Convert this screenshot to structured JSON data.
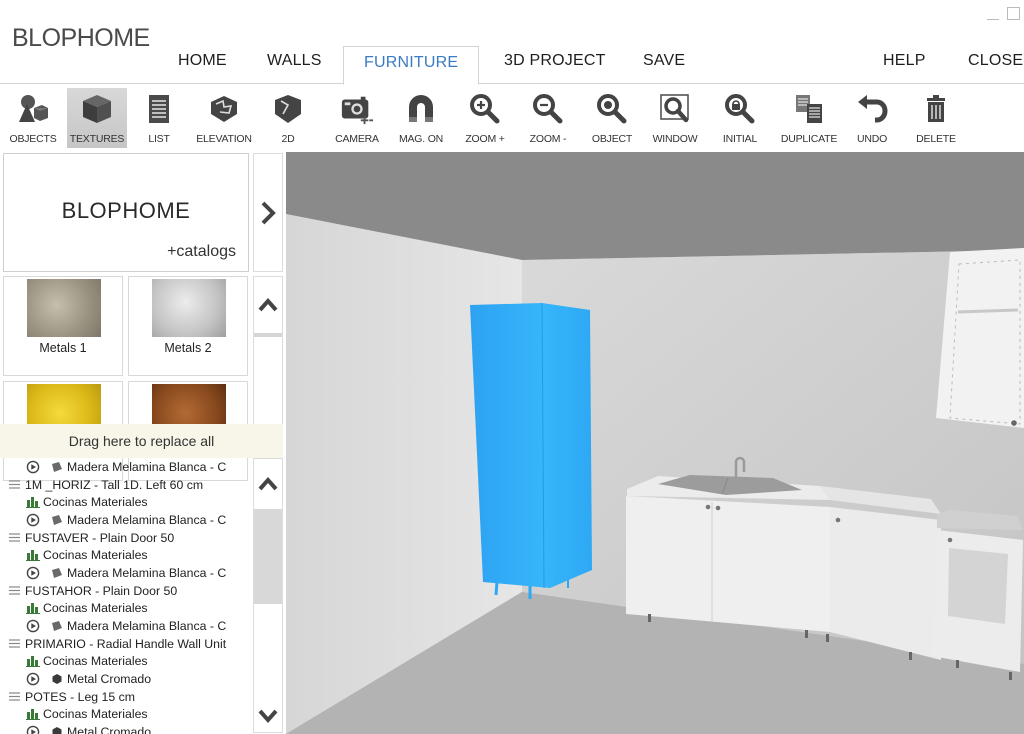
{
  "app": {
    "title": "BLOPHOME",
    "window_controls": {
      "minimize": "minimize",
      "maximize": "maximize"
    }
  },
  "menu": {
    "items": [
      {
        "label": "HOME",
        "active": false
      },
      {
        "label": "WALLS",
        "active": false
      },
      {
        "label": "FURNITURE",
        "active": true
      },
      {
        "label": "3D PROJECT",
        "active": false
      },
      {
        "label": "SAVE",
        "active": false
      },
      {
        "label": "HELP",
        "active": false
      },
      {
        "label": "CLOSE",
        "active": false
      }
    ]
  },
  "toolbar": {
    "tools": [
      {
        "label": "OBJECTS",
        "icon": "objects-icon",
        "active": false
      },
      {
        "label": "TEXTURES",
        "icon": "cube-icon",
        "active": true
      },
      {
        "label": "LIST",
        "icon": "list-icon",
        "active": false
      },
      {
        "label": "ELEVATION",
        "icon": "elevation-icon",
        "active": false
      },
      {
        "label": "2D",
        "icon": "plan-2d-icon",
        "active": false
      },
      {
        "label": "CAMERA",
        "icon": "camera-icon",
        "active": false
      },
      {
        "label": "MAG. ON",
        "icon": "magnet-icon",
        "active": false
      },
      {
        "label": "ZOOM +",
        "icon": "zoom-in-icon",
        "active": false
      },
      {
        "label": "ZOOM -",
        "icon": "zoom-out-icon",
        "active": false
      },
      {
        "label": "OBJECT",
        "icon": "zoom-object-icon",
        "active": false
      },
      {
        "label": "WINDOW",
        "icon": "zoom-window-icon",
        "active": false
      },
      {
        "label": "INITIAL",
        "icon": "zoom-initial-icon",
        "active": false
      },
      {
        "label": "DUPLICATE",
        "icon": "duplicate-icon",
        "active": false
      },
      {
        "label": "UNDO",
        "icon": "undo-icon",
        "active": false
      },
      {
        "label": "DELETE",
        "icon": "trash-icon",
        "active": false
      }
    ]
  },
  "catalog": {
    "brand": "BLOPHOME",
    "subtitle": "+catalogs"
  },
  "textures": {
    "items": [
      {
        "label": "Metals 1",
        "color": "#a39a88"
      },
      {
        "label": "Metals 2",
        "color": "#c9c9c9"
      },
      {
        "label": "",
        "color": "#e3c21c"
      },
      {
        "label": "",
        "color": "#8a4a1e"
      }
    ]
  },
  "drop_zone": {
    "label": "Drag here to replace all"
  },
  "material_tree": {
    "rows": [
      {
        "level": 2,
        "icon": "play-icon",
        "sub_icon": "material-swatch-icon",
        "text": "Madera Melamina Blanca - C"
      },
      {
        "level": 0,
        "icon": "list-lines-icon",
        "text": "1M _HORIZ - Tall 1D. Left 60 cm"
      },
      {
        "level": 1,
        "icon": "catalog-icon",
        "text": "Cocinas Materiales"
      },
      {
        "level": 2,
        "icon": "play-icon",
        "sub_icon": "material-swatch-icon",
        "text": "Madera Melamina Blanca - C"
      },
      {
        "level": 0,
        "icon": "list-lines-icon",
        "text": "FUSTAVER - Plain Door 50"
      },
      {
        "level": 1,
        "icon": "catalog-icon",
        "text": "Cocinas Materiales"
      },
      {
        "level": 2,
        "icon": "play-icon",
        "sub_icon": "material-swatch-icon",
        "text": "Madera Melamina Blanca - C"
      },
      {
        "level": 0,
        "icon": "list-lines-icon",
        "text": "FUSTAHOR - Plain Door 50"
      },
      {
        "level": 1,
        "icon": "catalog-icon",
        "text": "Cocinas Materiales"
      },
      {
        "level": 2,
        "icon": "play-icon",
        "sub_icon": "material-swatch-icon",
        "text": "Madera Melamina Blanca - C"
      },
      {
        "level": 0,
        "icon": "list-lines-icon",
        "text": "PRIMARIO - Radial Handle Wall Unit"
      },
      {
        "level": 1,
        "icon": "catalog-icon",
        "text": "Cocinas Materiales"
      },
      {
        "level": 2,
        "icon": "play-icon",
        "sub_icon": "metal-swatch-icon",
        "text": "Metal Cromado"
      },
      {
        "level": 0,
        "icon": "list-lines-icon",
        "text": "POTES - Leg 15 cm"
      },
      {
        "level": 1,
        "icon": "catalog-icon",
        "text": "Cocinas Materiales"
      },
      {
        "level": 2,
        "icon": "play-icon",
        "sub_icon": "metal-swatch-icon",
        "text": "Metal Cromado"
      }
    ]
  },
  "viewport": {
    "selected_object_color": "#2eaaf5",
    "ceiling_color": "#8a8a8a",
    "floor_color": "#b3b3b3"
  },
  "colors": {
    "accent": "#3b7bc4",
    "active_tool_bg": "#cccccc",
    "drop_zone_bg": "#f8f6e9"
  }
}
